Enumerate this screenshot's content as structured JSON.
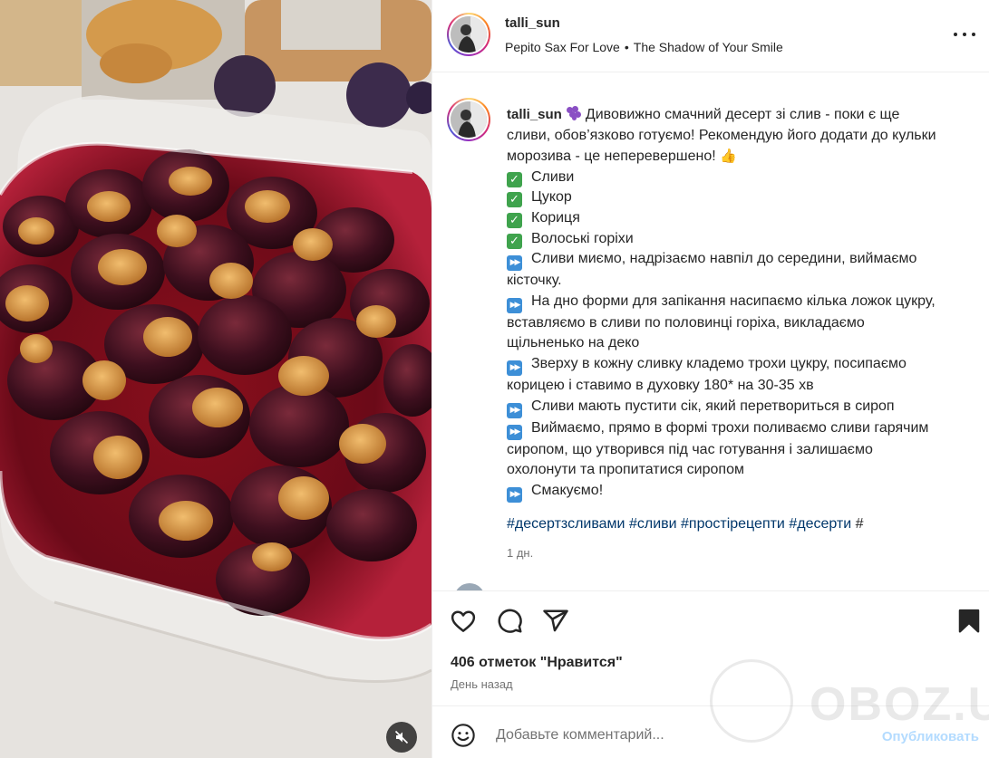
{
  "header": {
    "username": "talli_sun",
    "audio_artist": "Pepito Sax For Love",
    "audio_separator": "•",
    "audio_title": "The Shadow of Your Smile"
  },
  "caption": {
    "username": "talli_sun",
    "intro_lines": [
      "Дивовижно смачний десерт зі слив - поки є ще",
      "сливи, обов’язково готуємо! Рекомендую його додати до кульки",
      "морозива - це неперевершено!"
    ],
    "ingredients": [
      "Сливи",
      "Цукор",
      "Кориця",
      "Волоські горіхи"
    ],
    "steps": [
      [
        "Сливи миємо, надрізаємо навпіл до середини, виймаємо",
        "кісточку."
      ],
      [
        "На дно форми для запікання насипаємо кілька ложок цукру,",
        "вставляємо в сливи по половинці горіха, викладаємо",
        "щільненько на деко"
      ],
      [
        "Зверху в кожну сливку кладемо трохи цукру, посипаємо",
        "корицею і ставимо в духовку 180* на 30-35 хв"
      ],
      [
        "Сливи мають пустити сік, який перетвориться в сироп"
      ],
      [
        "Виймаємо, прямо в формі трохи поливаємо сливи гарячим",
        "сиропом, що утворився під час готування і залишаємо",
        "охолонути та пропитатися сиропом"
      ],
      [
        "Смакуємо!"
      ]
    ],
    "hashtags": [
      "#десертзсливами",
      "#сливи",
      "#простірецепти",
      "#десерти",
      "#"
    ],
    "time_ago": "1 дн.",
    "icons": {
      "ingredient_bullet": "check-mark-button-icon",
      "step_bullet": "fast-forward-icon",
      "after_username": "grapes-icon",
      "after_intro": "thumbs-up-icon"
    }
  },
  "actions": {
    "likes": "406 отметок \"Нравится\"",
    "date": "День назад",
    "icons": [
      "heart-icon",
      "comment-icon",
      "share-icon",
      "bookmark-icon"
    ]
  },
  "comment_box": {
    "placeholder": "Добавьте комментарий...",
    "publish_label": "Опубликовать"
  },
  "watermark": {
    "text": "OBOZ.UA"
  },
  "colors": {
    "link": "#00376b",
    "publish_disabled": "#b3dbff",
    "secondary_text": "#737373"
  }
}
